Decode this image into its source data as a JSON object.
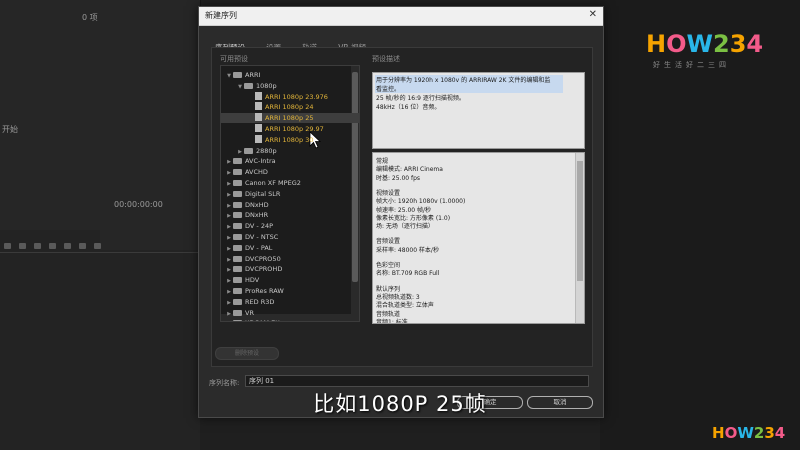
{
  "background": {
    "left_count": "0 项",
    "left_label": "开始",
    "timecode": "00:00:00:00"
  },
  "dialog": {
    "title": "新建序列",
    "close": "✕",
    "tabs": [
      {
        "label": "序列预设",
        "active": true
      },
      {
        "label": "设置",
        "active": false
      },
      {
        "label": "轨道",
        "active": false
      },
      {
        "label": "VR 视频",
        "active": false
      }
    ],
    "available_presets_label": "可用预设",
    "preset_desc_label": "预设描述",
    "tree": [
      {
        "label": "ARRI",
        "level": 0,
        "type": "folder",
        "expanded": true
      },
      {
        "label": "1080p",
        "level": 1,
        "type": "folder",
        "expanded": true
      },
      {
        "label": "ARRI 1080p 23.976",
        "level": 2,
        "type": "file"
      },
      {
        "label": "ARRI 1080p 24",
        "level": 2,
        "type": "file"
      },
      {
        "label": "ARRI 1080p 25",
        "level": 2,
        "type": "file",
        "selected": true
      },
      {
        "label": "ARRI 1080p 29.97",
        "level": 2,
        "type": "file"
      },
      {
        "label": "ARRI 1080p 30",
        "level": 2,
        "type": "file"
      },
      {
        "label": "2880p",
        "level": 1,
        "type": "folder",
        "expanded": false
      },
      {
        "label": "AVC-Intra",
        "level": 0,
        "type": "folder"
      },
      {
        "label": "AVCHD",
        "level": 0,
        "type": "folder"
      },
      {
        "label": "Canon XF MPEG2",
        "level": 0,
        "type": "folder"
      },
      {
        "label": "Digital SLR",
        "level": 0,
        "type": "folder"
      },
      {
        "label": "DNxHD",
        "level": 0,
        "type": "folder"
      },
      {
        "label": "DNxHR",
        "level": 0,
        "type": "folder"
      },
      {
        "label": "DV - 24P",
        "level": 0,
        "type": "folder"
      },
      {
        "label": "DV - NTSC",
        "level": 0,
        "type": "folder"
      },
      {
        "label": "DV - PAL",
        "level": 0,
        "type": "folder"
      },
      {
        "label": "DVCPRO50",
        "level": 0,
        "type": "folder"
      },
      {
        "label": "DVCPROHD",
        "level": 0,
        "type": "folder"
      },
      {
        "label": "HDV",
        "level": 0,
        "type": "folder"
      },
      {
        "label": "ProRes RAW",
        "level": 0,
        "type": "folder"
      },
      {
        "label": "RED R3D",
        "level": 0,
        "type": "folder"
      },
      {
        "label": "VR",
        "level": 0,
        "type": "folder"
      },
      {
        "label": "XDCAM EX",
        "level": 0,
        "type": "folder"
      }
    ],
    "description": [
      "用于分辨率为 1920h x 1080v 的 ARRIRAW 2K 文件的编辑和监",
      "看监控。",
      "25 帧/秒的 16:9 逐行扫描视频。",
      "48kHz（16 位）音频。"
    ],
    "info": [
      {
        "text": "常规",
        "gap": false
      },
      {
        "text": "编辑模式: ARRI Cinema",
        "gap": false
      },
      {
        "text": "时基: 25.00 fps",
        "gap": false
      },
      {
        "text": "视频设置",
        "gap": true
      },
      {
        "text": "帧大小: 1920h 1080v (1.0000)",
        "gap": false
      },
      {
        "text": "帧速率: 25.00 帧/秒",
        "gap": false
      },
      {
        "text": "像素长宽比: 方形像素 (1.0)",
        "gap": false
      },
      {
        "text": "场: 无场（逐行扫描）",
        "gap": false
      },
      {
        "text": "音频设置",
        "gap": true
      },
      {
        "text": "采样率: 48000 样本/秒",
        "gap": false
      },
      {
        "text": "色彩空间",
        "gap": true
      },
      {
        "text": "名称: BT.709 RGB Full",
        "gap": false
      },
      {
        "text": "默认序列",
        "gap": true
      },
      {
        "text": "总视频轨道数: 3",
        "gap": false
      },
      {
        "text": "混合轨道类型: 立体声",
        "gap": false
      },
      {
        "text": "音频轨道",
        "gap": false
      },
      {
        "text": "音频1: 标准",
        "gap": false
      }
    ],
    "delete_button": "删除预设",
    "sequence_name_label": "序列名称:",
    "sequence_name_value": "序列 01",
    "ok_button": "确定",
    "cancel_button": "取消"
  },
  "subtitle": "比如1080P 25帧",
  "logo": {
    "text": "HOW234",
    "sub": "好生活好二三四"
  }
}
